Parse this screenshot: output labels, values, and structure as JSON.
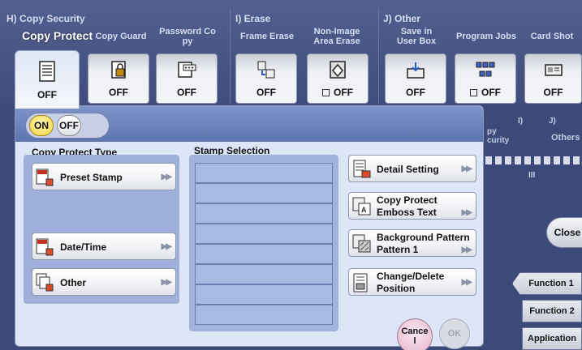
{
  "groups": {
    "copy_security": "H)  Copy Security",
    "erase": "I)   Erase",
    "other": "J)   Other"
  },
  "columns": {
    "copy_guard": "Copy Guard",
    "password_copy": "Password Co\npy",
    "frame_erase": "Frame Erase",
    "non_image_area_erase": "Non-Image\nArea Erase",
    "save_in_user_box": "Save in\nUser Box",
    "program_jobs": "Program Jobs",
    "card_shot": "Card Shot"
  },
  "copy_protect_title": "Copy Protect",
  "function_values": {
    "copy_protect": "OFF",
    "copy_guard": "OFF",
    "password_copy": "OFF",
    "frame_erase": "OFF",
    "non_image_area_erase": "OFF",
    "save_in_user_box": "OFF",
    "program_jobs": "OFF",
    "card_shot": "OFF"
  },
  "background": {
    "security_label": "py\ncurity",
    "col_i": "I)",
    "col_j": "J)",
    "others": "Others",
    "scroll_mark": "III",
    "close": "Close",
    "function_1": "Function 1",
    "function_2": "Function 2",
    "application": "Application"
  },
  "toggle": {
    "on": "ON",
    "off": "OFF",
    "selected": "ON"
  },
  "copy_protect_type": {
    "label": "Copy Protect Type",
    "preset_stamp": "Preset Stamp",
    "date_time": "Date/Time",
    "other": "Other"
  },
  "stamp_selection": {
    "label": "Stamp Selection",
    "rows": [
      "",
      "",
      "",
      "",
      "",
      "",
      "",
      ""
    ]
  },
  "settings": {
    "detail_setting": "Detail Setting",
    "copy_protect_line1": "Copy Protect",
    "copy_protect_line2": "Emboss Text",
    "background_line1": "Background Pattern",
    "background_line2": "Pattern 1",
    "change_line1": "Change/Delete",
    "change_line2": "Position"
  },
  "footer": {
    "cancel": "Cance\nl",
    "ok": "OK"
  },
  "arrow_glyph": "▶▶"
}
